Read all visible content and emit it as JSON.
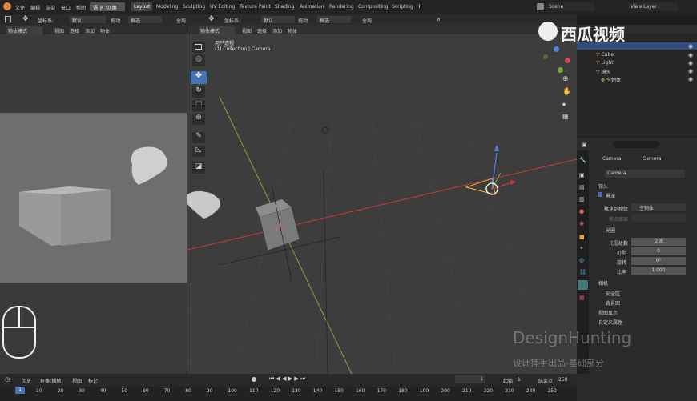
{
  "topbar": {
    "menus": [
      "文件",
      "编辑",
      "渲染",
      "窗口",
      "帮助"
    ],
    "lang_toggle": "语 言 切 换",
    "workspaces": [
      "Layout",
      "Modeling",
      "Sculpting",
      "UV Editing",
      "Texture Paint",
      "Shading",
      "Animation",
      "Rendering",
      "Compositing",
      "Scripting"
    ],
    "add_tab": "+",
    "scene": "Scene",
    "view_layer": "View Layer"
  },
  "header_row2": {
    "left": {
      "coord_label": "坐标系:",
      "coord_value": "默认",
      "drag_label": "拖动",
      "drag_value": "框选",
      "global": "全局"
    },
    "right": {
      "coord_label": "坐标系:",
      "coord_value": "默认",
      "drag_label": "拖动",
      "drag_value": "框选",
      "global": "全局"
    }
  },
  "left_view": {
    "mode": "物体模式",
    "menus": [
      "视图",
      "选择",
      "添加",
      "物体"
    ]
  },
  "main_view": {
    "mode": "物体模式",
    "menus": [
      "视图",
      "选择",
      "添加",
      "物体"
    ],
    "view_name": "用户透视",
    "collection": "(1) Collection | Camera"
  },
  "outliner": {
    "items": [
      {
        "label": "Cube",
        "color": "#c98f60"
      },
      {
        "label": "Light",
        "color": "#c98f60"
      },
      {
        "label": "镜头",
        "color": "#c98f60"
      },
      {
        "label": "空物体",
        "color": "#c98f60"
      }
    ]
  },
  "watermark": {
    "brand": "西瓜视频",
    "line1": "DesignHunting",
    "line2": "设计捕手出品-基础部分"
  },
  "properties": {
    "obj_tab": "Camera",
    "data_tab": "Camera",
    "data_name": "Camera",
    "sections": {
      "lens": "镜头",
      "dof": "景深",
      "aperture": "光圈",
      "camera": "相机",
      "safe_areas": "安全区",
      "background": "背景图",
      "viewport": "视图显示",
      "custom_props": "自定义属性"
    },
    "focus_object_label": "聚焦到物体",
    "focus_object_value": "空物体",
    "focus_distance_label": "焦点距离",
    "fstop_label": "光圈级数",
    "fstop_value": "2.8",
    "blades_label": "刃型",
    "blades_value": "0",
    "rotation_label": "旋转",
    "rotation_value": "0°",
    "ratio_label": "比率",
    "ratio_value": "1.000"
  },
  "timeline": {
    "menus": [
      "回放",
      "抠像(插帧)",
      "视图",
      "标记"
    ],
    "current_frame": "1",
    "start_label": "起始",
    "start_value": "1",
    "end_label": "结束点",
    "end_value": "250",
    "ticks": [
      "10",
      "20",
      "30",
      "40",
      "50",
      "60",
      "70",
      "80",
      "90",
      "100",
      "110",
      "120",
      "130",
      "140",
      "150",
      "160",
      "170",
      "180",
      "190",
      "200",
      "210",
      "220",
      "230",
      "240",
      "250"
    ],
    "frame_badge": "1"
  },
  "colors": {
    "accent": "#4772b3",
    "axis_x": "#c93c3c",
    "axis_y": "#8ba03c",
    "viewport_bg": "#3d3d3d"
  }
}
